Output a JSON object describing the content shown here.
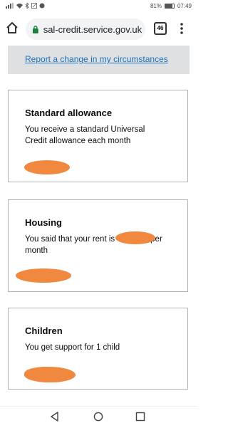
{
  "status": {
    "icons_left": "signal-wifi-icons",
    "battery": "81%",
    "battery_level": 0.81,
    "time": "07:49"
  },
  "browser": {
    "url": "sal-credit.service.gov.uk",
    "tab_count": "46"
  },
  "report": {
    "link_text": "Report a change in my circumstances"
  },
  "cards": {
    "standard": {
      "title": "Standard allowance",
      "text": "You receive a standard Universal Credit allowance each month"
    },
    "housing": {
      "title": "Housing",
      "text_before": "You said that your rent is",
      "text_after": "per",
      "text_line2": "month"
    },
    "children": {
      "title": "Children",
      "text": "You get support for 1 child"
    }
  },
  "colors": {
    "link": "#1d70b8",
    "redaction": "#f0883f",
    "border": "#b1b4b6",
    "panel": "#dee0e2"
  }
}
